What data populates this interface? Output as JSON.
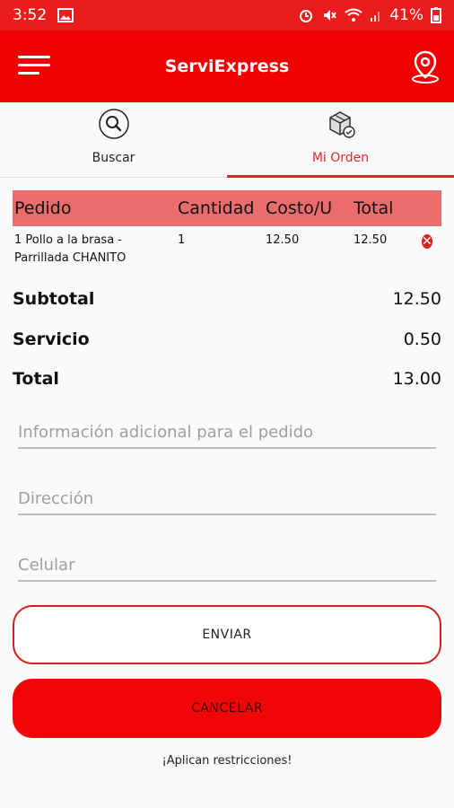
{
  "status_bar": {
    "time": "3:52",
    "battery": "41%",
    "icons": [
      "image-icon",
      "alarm-icon",
      "mute-icon",
      "wifi-icon",
      "signal-icon",
      "battery-icon"
    ]
  },
  "app_bar": {
    "title": "ServiExpress",
    "left_icon": "menu-icon",
    "right_icon": "location-pin-icon"
  },
  "tabs": [
    {
      "label": "Buscar",
      "icon": "search-icon",
      "active": false
    },
    {
      "label": "Mi Orden",
      "icon": "box-icon",
      "active": true
    }
  ],
  "order": {
    "columns": [
      "Pedido",
      "Cantidad",
      "Costo/U",
      "Total"
    ],
    "rows": [
      {
        "pedido": "1 Pollo a la brasa - Parrillada CHANITO",
        "cantidad": "1",
        "costo": "12.50",
        "total": "12.50"
      }
    ]
  },
  "summary": {
    "subtotal_label": "Subtotal",
    "subtotal_value": "12.50",
    "servicio_label": "Servicio",
    "servicio_value": "0.50",
    "total_label": "Total",
    "total_value": "13.00"
  },
  "form": {
    "info_placeholder": "Información adicional para el pedido",
    "direccion_placeholder": "Dirección",
    "celular_placeholder": "Celular"
  },
  "buttons": {
    "send": "ENVIAR",
    "cancel": "CANCELAR"
  },
  "note": "¡Aplican restricciones!",
  "colors": {
    "brand_red": "#f00000",
    "header_row": "#ec6b6b",
    "delete_red": "#e52020"
  }
}
